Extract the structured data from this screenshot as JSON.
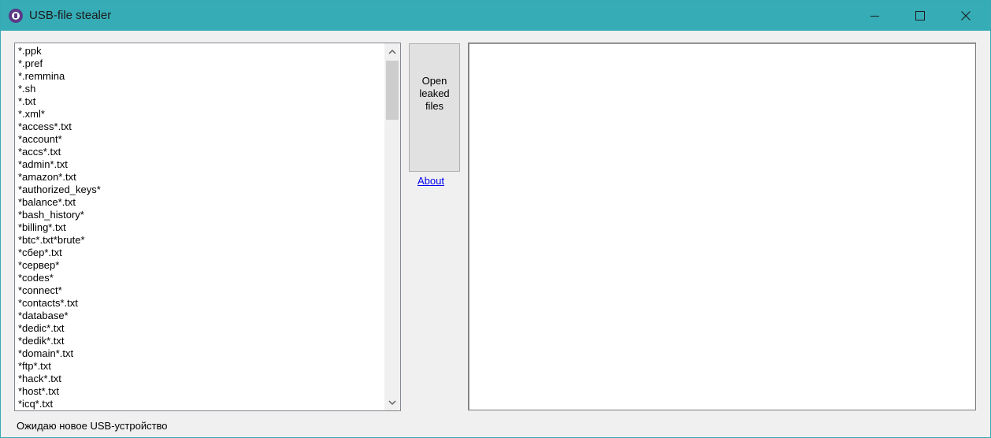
{
  "window": {
    "title": "USB-file stealer",
    "accent_color": "#36acb6"
  },
  "file_masks": [
    "*.ppk",
    "*.pref",
    "*.remmina",
    "*.sh",
    "*.txt",
    "*.xml*",
    "*access*.txt",
    "*account*",
    "*accs*.txt",
    "*admin*.txt",
    "*amazon*.txt",
    "*authorized_keys*",
    "*balance*.txt",
    "*bash_history*",
    "*billing*.txt",
    "*btc*.txt*brute*",
    "*сбер*.txt",
    "*сервер*",
    "*codes*",
    "*connect*",
    "*contacts*.txt",
    "*database*",
    "*dedic*.txt",
    "*dedik*.txt",
    "*domain*.txt",
    "*ftp*.txt",
    "*hack*.txt",
    "*host*.txt",
    "*icq*.txt"
  ],
  "buttons": {
    "open_leaked": "Open\nleaked\nfiles",
    "about": "About"
  },
  "status": "Ожидаю новое USB-устройство",
  "icons": {
    "app": "usb-stealer-app-icon",
    "minimize": "minimize-icon",
    "maximize": "maximize-icon",
    "close": "close-icon",
    "scroll_up": "chevron-up-icon",
    "scroll_down": "chevron-down-icon"
  }
}
